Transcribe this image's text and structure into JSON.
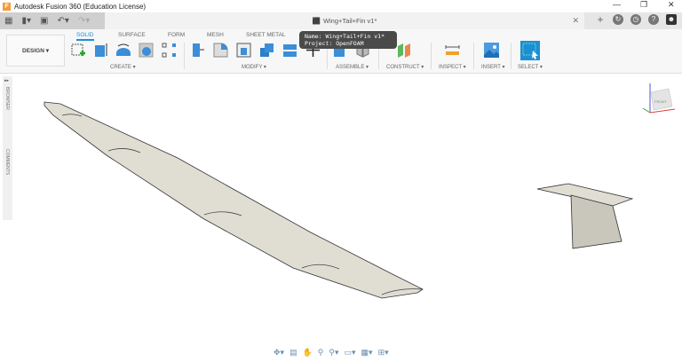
{
  "title": "Autodesk Fusion 360 (Education License)",
  "document_tab": "Wing+Tail+Fin v1*",
  "workspace": "DESIGN",
  "tabs": [
    "SOLID",
    "SURFACE",
    "FORM",
    "MESH",
    "SHEET METAL"
  ],
  "groups": {
    "create": "CREATE",
    "modify": "MODIFY",
    "assemble": "ASSEMBLE",
    "construct": "CONSTRUCT",
    "inspect": "INSPECT",
    "insert": "INSERT",
    "select": "SELECT"
  },
  "tooltip": {
    "name": "Name: Wing+Tail+Fin v1*",
    "project": "Project: OpenFOAM"
  },
  "side": {
    "browser": "BROWSER",
    "comments": "COMMENTS"
  },
  "viewcube": {
    "face": "FRONT"
  },
  "colors": {
    "accent": "#1b8fd6",
    "model": "#e0ddd3"
  }
}
